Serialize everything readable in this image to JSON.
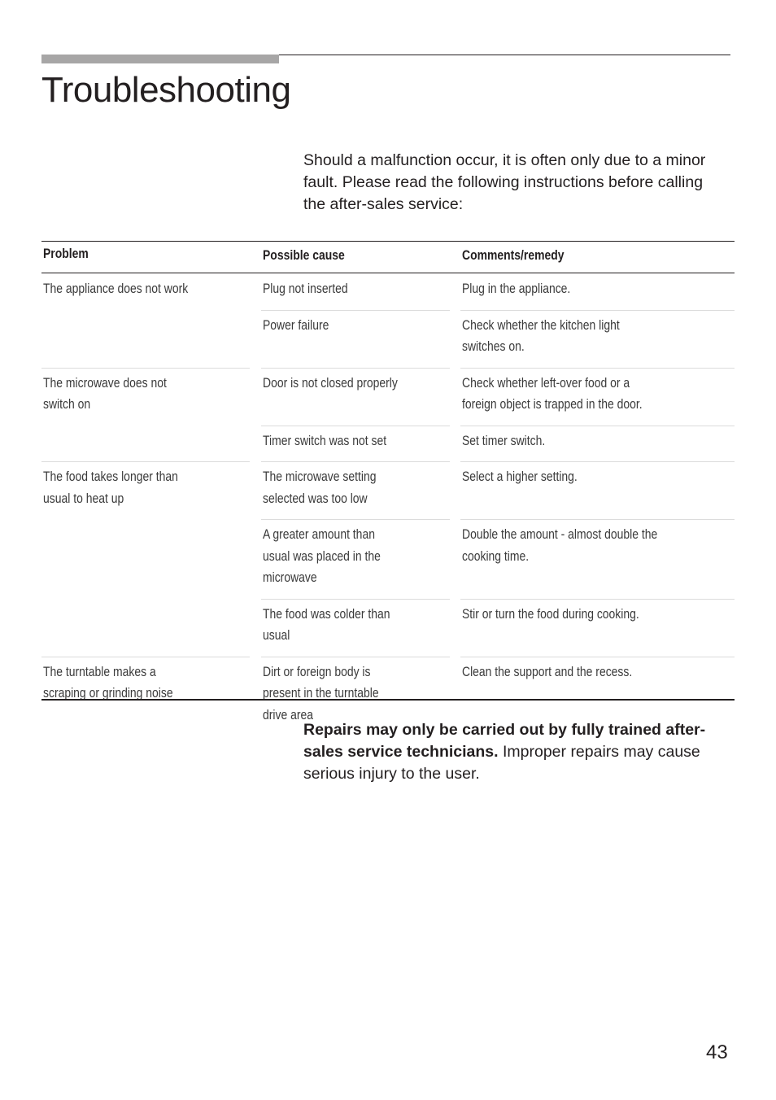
{
  "page": {
    "title": "Troubleshooting",
    "intro": "Should a malfunction occur, it is often only due to a minor fault. Please read the following instructions before calling the after-sales service:",
    "warning_bold": "Repairs may only be carried out by fully trained after-sales service technicians.",
    "warning_text": " Improper repairs may cause serious injury to the user.",
    "page_number": "43"
  },
  "table": {
    "headers": [
      "Problem",
      "Possible cause",
      "Comments/remedy"
    ],
    "groups": [
      {
        "problem": [
          "The appliance does not work"
        ],
        "rows": [
          {
            "cause": [
              "Plug not inserted"
            ],
            "remedy": [
              "Plug in the appliance."
            ]
          },
          {
            "cause": [
              "Power failure"
            ],
            "remedy": [
              "Check whether the kitchen light",
              "switches on."
            ]
          }
        ]
      },
      {
        "problem": [
          "The microwave does not",
          "switch on"
        ],
        "rows": [
          {
            "cause": [
              "Door is not closed properly"
            ],
            "remedy": [
              "Check whether left-over food or a",
              "foreign object is trapped in the door."
            ]
          },
          {
            "cause": [
              "Timer switch was not set"
            ],
            "remedy": [
              "Set timer switch."
            ]
          }
        ]
      },
      {
        "problem": [
          "The food takes longer than",
          "usual to heat up"
        ],
        "rows": [
          {
            "cause": [
              "The microwave setting",
              "selected was too low"
            ],
            "remedy": [
              "Select a higher setting."
            ]
          },
          {
            "cause": [
              "A greater amount than",
              "usual was placed in the",
              "microwave"
            ],
            "remedy": [
              "Double the amount - almost double the",
              "cooking time."
            ]
          },
          {
            "cause": [
              "The food was colder than",
              "usual"
            ],
            "remedy": [
              "Stir or turn the food during cooking."
            ]
          }
        ]
      },
      {
        "problem": [
          "The turntable makes a",
          "scraping or grinding noise"
        ],
        "rows": [
          {
            "cause": [
              "Dirt or foreign body is",
              "present in the turntable",
              "drive area"
            ],
            "remedy": [
              "Clean the support and the recess."
            ]
          }
        ]
      }
    ]
  }
}
